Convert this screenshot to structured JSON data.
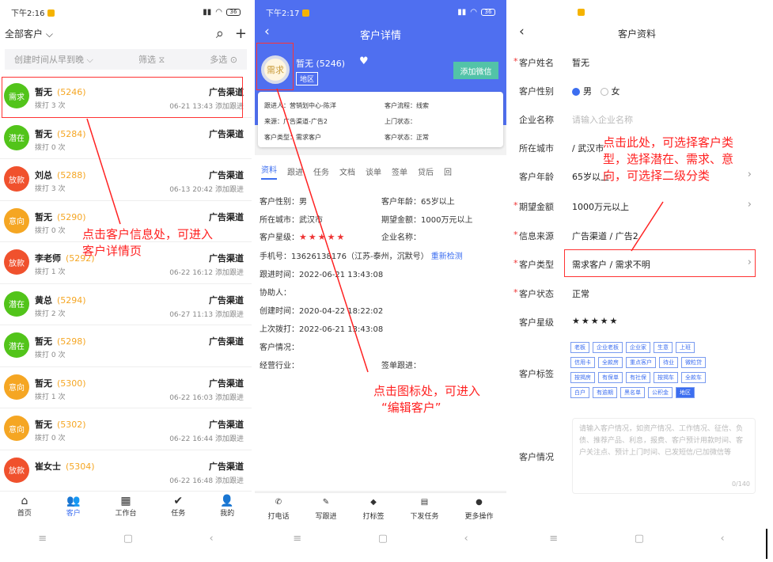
{
  "p1": {
    "status_time": "下午2:16",
    "battery": "36",
    "filter_label": "全部客户",
    "sort_label": "创建时间从早到晚",
    "filter_btn": "筛选",
    "multi_btn": "多选",
    "rows": [
      {
        "tag": "需求",
        "color": "#52c41a",
        "name": "暂无",
        "id": "(5246)",
        "dial": "拨打 3 次",
        "chan": "广告渠道",
        "time": "06-21 13:43 添加跟进"
      },
      {
        "tag": "潜在",
        "color": "#52c41a",
        "name": "暂无",
        "id": "(5284)",
        "dial": "拨打 0 次",
        "chan": "广告渠道",
        "time": ""
      },
      {
        "tag": "放款",
        "color": "#f0512d",
        "name": "刘总",
        "id": "(5288)",
        "dial": "拨打 3 次",
        "chan": "广告渠道",
        "time": "06-13 20:42 添加跟进"
      },
      {
        "tag": "意向",
        "color": "#f5a623",
        "name": "暂无",
        "id": "(5290)",
        "dial": "拨打 0 次",
        "chan": "广告渠道",
        "time": ""
      },
      {
        "tag": "放款",
        "color": "#f0512d",
        "name": "李老师",
        "id": "(5292)",
        "dial": "拨打 1 次",
        "chan": "广告渠道",
        "time": "06-22 16:12 添加跟进"
      },
      {
        "tag": "潜在",
        "color": "#52c41a",
        "name": "黄总",
        "id": "(5294)",
        "dial": "拨打 2 次",
        "chan": "广告渠道",
        "time": "06-27 11:13 添加跟进"
      },
      {
        "tag": "潜在",
        "color": "#52c41a",
        "name": "暂无",
        "id": "(5298)",
        "dial": "拨打 0 次",
        "chan": "广告渠道",
        "time": ""
      },
      {
        "tag": "意向",
        "color": "#f5a623",
        "name": "暂无",
        "id": "(5300)",
        "dial": "拨打 1 次",
        "chan": "广告渠道",
        "time": "06-22 16:03 添加跟进"
      },
      {
        "tag": "意向",
        "color": "#f5a623",
        "name": "暂无",
        "id": "(5302)",
        "dial": "拨打 0 次",
        "chan": "广告渠道",
        "time": "06-22 16:44 添加跟进"
      },
      {
        "tag": "放款",
        "color": "#f0512d",
        "name": "崔女士",
        "id": "(5304)",
        "dial": "",
        "chan": "广告渠道",
        "time": "06-22 16:48 添加跟进"
      }
    ],
    "tabs": [
      {
        "icon": "⌂",
        "label": "首页"
      },
      {
        "icon": "👥",
        "label": "客户"
      },
      {
        "icon": "▦",
        "label": "工作台"
      },
      {
        "icon": "✔",
        "label": "任务"
      },
      {
        "icon": "👤",
        "label": "我的"
      }
    ],
    "annotation_line1": "点击客户信息处，可进入",
    "annotation_line2": "客户详情页"
  },
  "p2": {
    "status_time": "下午2:17",
    "battery": "36",
    "title": "客户详情",
    "avatar_tag": "需求",
    "name": "暂无",
    "id": "(5246)",
    "region": "地区",
    "wechat_btn": "添加微信",
    "card": {
      "follower": "跟进人：营销划中心-陈洋",
      "flow": "客户流程：线索",
      "source": "来源：广告渠道-广告2",
      "visit": "上门状态：",
      "type": "客户类型：需求客户",
      "status": "客户状态：正常"
    },
    "tabs": [
      "资料",
      "跟进",
      "任务",
      "文档",
      "谈单",
      "签单",
      "贷后",
      "回"
    ],
    "fields": {
      "gender": "客户性别：男",
      "age": "客户年龄：65岁以上",
      "city": "所在城市：武汉市",
      "amount": "期望金额：1000万元以上",
      "star_label": "客户星级：",
      "stars": "★★★★★",
      "company": "企业名称：",
      "phone": "手机号：13626138176（江苏-泰州，沉默号）",
      "recheck": "重新检测",
      "follow_time": "跟进时间：2022-06-21 13:43:08",
      "assist": "协助人：",
      "created": "创建时间：2020-04-22 18:22:02",
      "last_dial": "上次拨打：2022-06-21 13:43:08",
      "situation": "客户情况：",
      "industry": "经营行业：",
      "sign": "签单跟进："
    },
    "actions": [
      {
        "icon": "✆",
        "label": "打电话"
      },
      {
        "icon": "✎",
        "label": "写跟进"
      },
      {
        "icon": "◆",
        "label": "打标签"
      },
      {
        "icon": "▤",
        "label": "下发任务"
      },
      {
        "icon": "●",
        "label": "更多操作"
      }
    ],
    "annotation_line1": "点击图标处，可进入",
    "annotation_line2": "“编辑客户”"
  },
  "p3": {
    "title": "客户资料",
    "name_label": "客户姓名",
    "name_val": "暂无",
    "gender_label": "客户性别",
    "male": "男",
    "female": "女",
    "company_label": "企业名称",
    "company_ph": "请输入企业名称",
    "city_label": "所在城市",
    "city_val": "/ 武汉市",
    "age_label": "客户年龄",
    "age_val": "65岁以上",
    "amount_label": "期望金额",
    "amount_val": "1000万元以上",
    "source_label": "信息来源",
    "source_val": "广告渠道 / 广告2",
    "type_label": "客户类型",
    "type_val": "需求客户 / 需求不明",
    "status_label": "客户状态",
    "status_val": "正常",
    "star_label": "客户星级",
    "stars": "★★★★★",
    "tag_label": "客户标签",
    "tags": [
      [
        "老板",
        "企业老板",
        "企业家",
        "生意",
        "上班"
      ],
      [
        "信用卡",
        "全款房",
        "重点客户",
        "待业",
        "微粒贷"
      ],
      [
        "按揭房",
        "有保单",
        "有社保",
        "按揭车",
        "全款车"
      ],
      [
        "白户",
        "有逾期",
        "黑名单",
        "公积金",
        "地区"
      ]
    ],
    "situation_label": "客户情况",
    "situation_ph": "请输入客户情况，如资产情况、工作情况、征信、负债、推荐产品、利息，报费、客户预计用款时间、客户关注点、预计上门时间、已发短信/已加微信等",
    "situation_count": "0/140",
    "annotation_line1": "点击此处，可选择客户类",
    "annotation_line2": "型，选择潜在、需求、意",
    "annotation_line3": "向，可选择二级分类"
  }
}
